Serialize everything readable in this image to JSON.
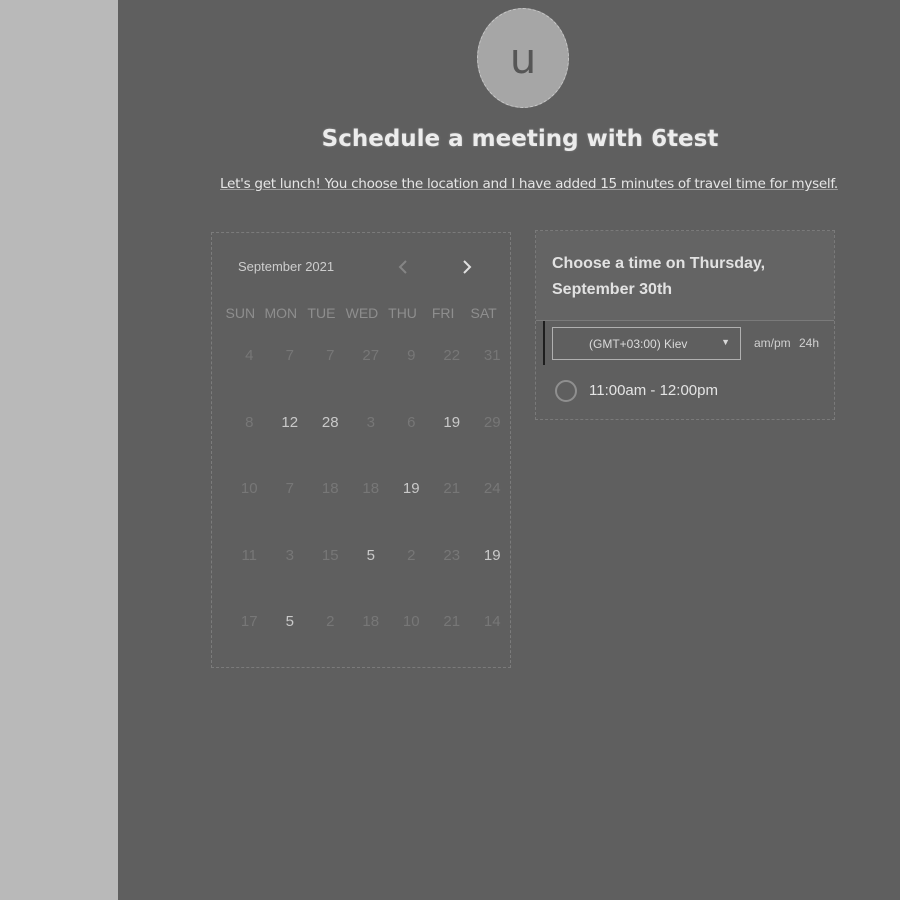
{
  "avatar": {
    "letter": "u"
  },
  "header": {
    "title": "Schedule a meeting with 6test",
    "subtitle": "Let's get lunch! You choose the location and I have added 15 minutes of travel time for myself."
  },
  "calendar": {
    "month_label": "September 2021",
    "prev_icon": "chevron-left-icon",
    "next_icon": "chevron-right-icon",
    "weekdays": [
      "SUN",
      "MON",
      "TUE",
      "WED",
      "THU",
      "FRI",
      "SAT"
    ],
    "weeks": [
      [
        {
          "d": "4",
          "a": false
        },
        {
          "d": "7",
          "a": false
        },
        {
          "d": "7",
          "a": false
        },
        {
          "d": "27",
          "a": false
        },
        {
          "d": "9",
          "a": false
        },
        {
          "d": "22",
          "a": false
        },
        {
          "d": "31",
          "a": false
        }
      ],
      [
        {
          "d": "8",
          "a": false
        },
        {
          "d": "12",
          "a": true
        },
        {
          "d": "28",
          "a": true
        },
        {
          "d": "3",
          "a": false
        },
        {
          "d": "6",
          "a": false
        },
        {
          "d": "19",
          "a": true
        },
        {
          "d": "29",
          "a": false
        }
      ],
      [
        {
          "d": "10",
          "a": false
        },
        {
          "d": "7",
          "a": false
        },
        {
          "d": "18",
          "a": false
        },
        {
          "d": "18",
          "a": false
        },
        {
          "d": "19",
          "a": true
        },
        {
          "d": "21",
          "a": false
        },
        {
          "d": "24",
          "a": false
        }
      ],
      [
        {
          "d": "11",
          "a": false
        },
        {
          "d": "3",
          "a": false
        },
        {
          "d": "15",
          "a": false
        },
        {
          "d": "5",
          "a": true
        },
        {
          "d": "2",
          "a": false
        },
        {
          "d": "23",
          "a": false
        },
        {
          "d": "19",
          "a": true
        }
      ],
      [
        {
          "d": "17",
          "a": false
        },
        {
          "d": "5",
          "a": true
        },
        {
          "d": "2",
          "a": false
        },
        {
          "d": "18",
          "a": false
        },
        {
          "d": "10",
          "a": false
        },
        {
          "d": "21",
          "a": false
        },
        {
          "d": "14",
          "a": false
        }
      ]
    ]
  },
  "time_panel": {
    "heading": "Choose a time on Thursday, September 30th",
    "timezone_value": "(GMT+03:00) Kiev",
    "format_ampm": "am/pm",
    "format_24h": "24h",
    "slots": [
      "11:00am - 12:00pm"
    ]
  },
  "colors": {
    "background": "#5f5f5f",
    "sidebar": "#b9b9b9",
    "avatar": "#a6a6a6"
  }
}
